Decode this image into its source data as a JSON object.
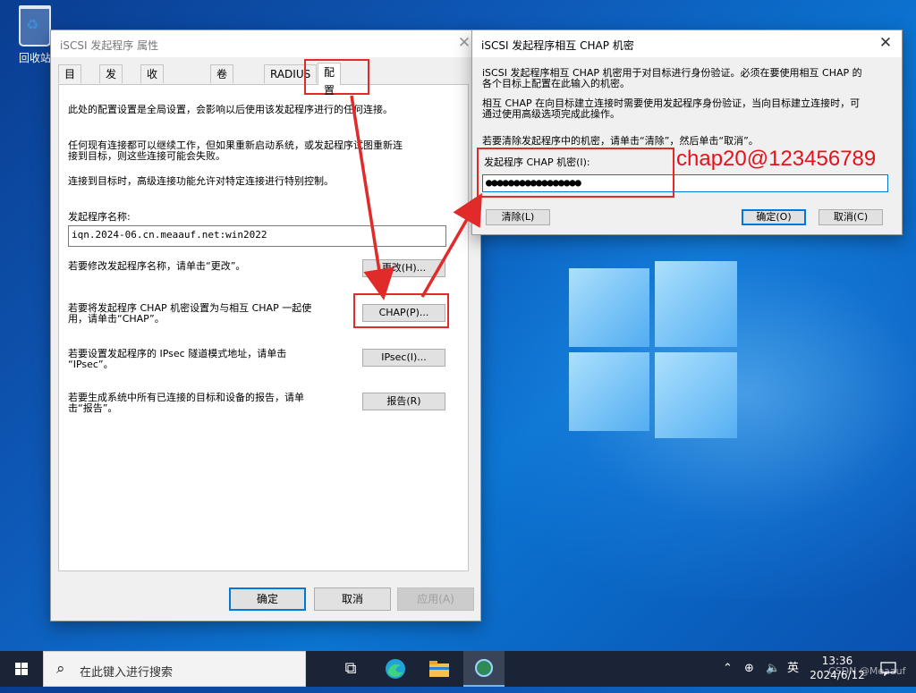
{
  "desktop": {
    "recycle_bin_label": "回收站"
  },
  "main_dialog": {
    "title": "iSCSI 发起程序 属性",
    "tabs": [
      "目标",
      "发现",
      "收藏的目标",
      "卷和设备",
      "RADIUS",
      "配置"
    ],
    "active_tab": "配置",
    "config_text": "此处的配置设置是全局设置，会影响以后使用该发起程序进行的任何连接。",
    "reconnect_text_1": "任何现有连接都可以继续工作，但如果重新启动系统，或发起程序试图重新连",
    "reconnect_text_2": "接到目标，则这些连接可能会失败。",
    "advanced_text": "连接到目标时，高级连接功能允许对特定连接进行特别控制。",
    "initiator_name_label": "发起程序名称:",
    "initiator_name_value": "iqn.2024-06.cn.meaauf.net:win2022",
    "change_text": "若要修改发起程序名称，请单击“更改”。",
    "change_button": "更改(H)...",
    "chap_text_1": "若要将发起程序 CHAP 机密设置为与相互 CHAP 一起使",
    "chap_text_2": "用，请单击“CHAP”。",
    "chap_button": "CHAP(P)...",
    "ipsec_text_1": "若要设置发起程序的 IPsec 隧道模式地址，请单击",
    "ipsec_text_2": "“IPsec”。",
    "ipsec_button": "IPsec(I)...",
    "report_text_1": "若要生成系统中所有已连接的目标和设备的报告，请单",
    "report_text_2": "击“报告”。",
    "report_button": "报告(R)",
    "ok_button": "确定",
    "cancel_button": "取消",
    "apply_button": "应用(A)"
  },
  "chap_dialog": {
    "title": "iSCSI 发起程序相互 CHAP 机密",
    "desc_1": "iSCSI 发起程序相互 CHAP 机密用于对目标进行身份验证。必须在要使用相互 CHAP 的",
    "desc_2": "各个目标上配置在此输入的机密。",
    "desc_3": "相互 CHAP 在向目标建立连接时需要使用发起程序身份验证，当向目标建立连接时，可",
    "desc_4": "通过使用高级选项完成此操作。",
    "clear_hint": "若要清除发起程序中的机密，请单击“清除”，然后单击“取消”。",
    "secret_label": "发起程序 CHAP 机密(I):",
    "secret_value": "●●●●●●●●●●●●●●●●●",
    "clear_button": "清除(L)",
    "ok_button": "确定(O)",
    "cancel_button": "取消(C)"
  },
  "annotation": {
    "text": "chap20@123456789",
    "color": "#e8101a"
  },
  "taskbar": {
    "search_placeholder": "在此键入进行搜索",
    "ime": "英",
    "time": "13:36",
    "date": "2024/6/12"
  },
  "watermark": "CSDN @Meaauf"
}
